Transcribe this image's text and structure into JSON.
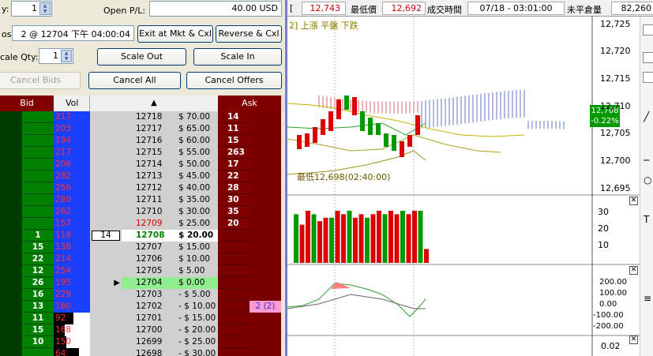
{
  "order_form": {
    "qty_label": "y:",
    "qty_value": "1",
    "open_pl_label": "Open P/L:",
    "open_pl_value": "40.00 USD",
    "pos_label": "os:",
    "pos_value": "2 @ 12704 下午 04:00:04",
    "exit_button": "Exit at Mkt & Cxl",
    "reverse_button": "Reverse & Cxl",
    "scale_qty_label": "cale Qty:",
    "scale_qty_value": "1",
    "scale_out_button": "Scale Out",
    "scale_in_button": "Scale In",
    "cancel_bids_button": "Cancel Bids",
    "cancel_all_button": "Cancel All",
    "cancel_offers_button": "Cancel Offers"
  },
  "ladder": {
    "headers": {
      "bid": "Bid",
      "vol": "Vol",
      "ask": "Ask"
    },
    "rows": [
      {
        "bid": "",
        "vol": "217",
        "price": "12718",
        "pl": "$ 70.00",
        "ask": "14",
        "order": "",
        "volbar": 0
      },
      {
        "bid": "",
        "vol": "203",
        "price": "12717",
        "pl": "$ 65.00",
        "ask": "11",
        "order": "",
        "volbar": 0
      },
      {
        "bid": "",
        "vol": "194",
        "price": "12716",
        "pl": "$ 60.00",
        "ask": "15",
        "order": "",
        "volbar": 0
      },
      {
        "bid": "",
        "vol": "217",
        "price": "12715",
        "pl": "$ 55.00",
        "ask": "263",
        "order": "",
        "volbar": 0
      },
      {
        "bid": "",
        "vol": "206",
        "price": "12714",
        "pl": "$ 50.00",
        "ask": "17",
        "order": "",
        "volbar": 0
      },
      {
        "bid": "",
        "vol": "282",
        "price": "12713",
        "pl": "$ 45.00",
        "ask": "22",
        "order": "",
        "volbar": 0
      },
      {
        "bid": "",
        "vol": "256",
        "price": "12712",
        "pl": "$ 40.00",
        "ask": "28",
        "order": "",
        "volbar": 0
      },
      {
        "bid": "",
        "vol": "280",
        "price": "12711",
        "pl": "$ 35.00",
        "ask": "30",
        "order": "",
        "volbar": 0
      },
      {
        "bid": "",
        "vol": "262",
        "price": "12710",
        "pl": "$ 30.00",
        "ask": "35",
        "order": "",
        "volbar": 0
      },
      {
        "bid": "",
        "vol": "157",
        "price": "12709",
        "pl": "$ 25.00",
        "ask": "20",
        "order": "",
        "volbar": 0
      },
      {
        "bid": "1",
        "vol": "118",
        "price": "12708",
        "pl": "$ 20.00",
        "ask": "",
        "order": "",
        "volbar": 0,
        "last": "14"
      },
      {
        "bid": "15",
        "vol": "138",
        "price": "12707",
        "pl": "$ 15.00",
        "ask": "",
        "order": "",
        "volbar": 0
      },
      {
        "bid": "22",
        "vol": "214",
        "price": "12706",
        "pl": "$ 10.00",
        "ask": "",
        "order": "",
        "volbar": 0
      },
      {
        "bid": "12",
        "vol": "254",
        "price": "12705",
        "pl": "$ 5.00",
        "ask": "",
        "order": "",
        "volbar": 0
      },
      {
        "bid": "26",
        "vol": "195",
        "price": "12704",
        "pl": "$ 0.00",
        "ask": "",
        "order": "",
        "volbar": 0
      },
      {
        "bid": "16",
        "vol": "229",
        "price": "12703",
        "pl": "- $ 5.00",
        "ask": "",
        "order": "",
        "volbar": 0
      },
      {
        "bid": "13",
        "vol": "160",
        "price": "12702",
        "pl": "- $ 10.00",
        "ask": "",
        "order": "2 (2)",
        "volbar": 0
      },
      {
        "bid": "11",
        "vol": "92",
        "price": "12701",
        "pl": "- $ 15.00",
        "ask": "",
        "order": "",
        "volbar": 0.55
      },
      {
        "bid": "15",
        "vol": "168",
        "price": "12700",
        "pl": "- $ 20.00",
        "ask": "",
        "order": "",
        "volbar": 0.3
      },
      {
        "bid": "10",
        "vol": "150",
        "price": "12699",
        "pl": "- $ 25.00",
        "ask": "",
        "order": "",
        "volbar": 0.35
      },
      {
        "bid": "",
        "vol": "64",
        "price": "12698",
        "pl": "- $ 30.00",
        "ask": "",
        "order": "",
        "volbar": 0.7
      }
    ]
  },
  "quote_bar": {
    "item1": "12,743",
    "low_label": "最低價",
    "low_value": "12,692",
    "time_label": "成交時間",
    "time_value": "07/18 - 03:01:00",
    "oi_label": "未平倉量",
    "oi_value": "82,260"
  },
  "chart_legend": {
    "text": "2] 上漲  平盤  下跌"
  },
  "low_annotation": "最低12,698(02:40:00)",
  "price_tag": {
    "price": "12,708",
    "change": "-0.22%"
  },
  "price_axis": [
    "12,725",
    "12,720",
    "12,715",
    "12,710",
    "12,705",
    "12,700",
    "12,695"
  ],
  "volume_axis": [
    "30",
    "20",
    "10"
  ],
  "osc_axis": [
    "200.00",
    "100.00",
    "0.00",
    "-100.00",
    "-200.00"
  ],
  "bottom_axis": "0.02",
  "colors": {
    "bid_green": "#008000",
    "ask_maroon": "#800000",
    "vol_blue": "#0000ff",
    "up_red": "#dd0000",
    "down_green": "#009900"
  }
}
